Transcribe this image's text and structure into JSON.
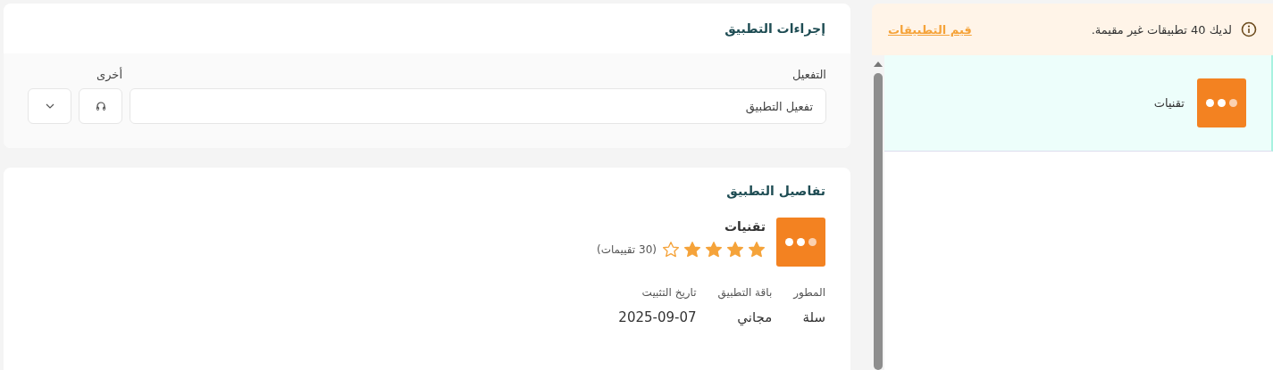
{
  "app_actions": {
    "title": "إجراءات التطبيق",
    "activation_label": "التفعيل",
    "activation_value": "تفعيل التطبيق",
    "other_label": "أخرى"
  },
  "app_details": {
    "title": "تفاصيل التطبيق",
    "name": "تقنيات",
    "stars": 4,
    "ratings": "(30 تقييمات)",
    "fields": [
      {
        "label": "المطور",
        "value": "سلة"
      },
      {
        "label": "باقة التطبيق",
        "value": "مجاني"
      },
      {
        "label": "تاريخ التثبيت",
        "value": "2025-09-07"
      }
    ]
  },
  "banner": {
    "message": "لديك 40 تطبيقات غير مقيمة.",
    "link": "قيم التطبيقات"
  },
  "apps": [
    {
      "name": "تقنيات",
      "selected": true
    }
  ]
}
